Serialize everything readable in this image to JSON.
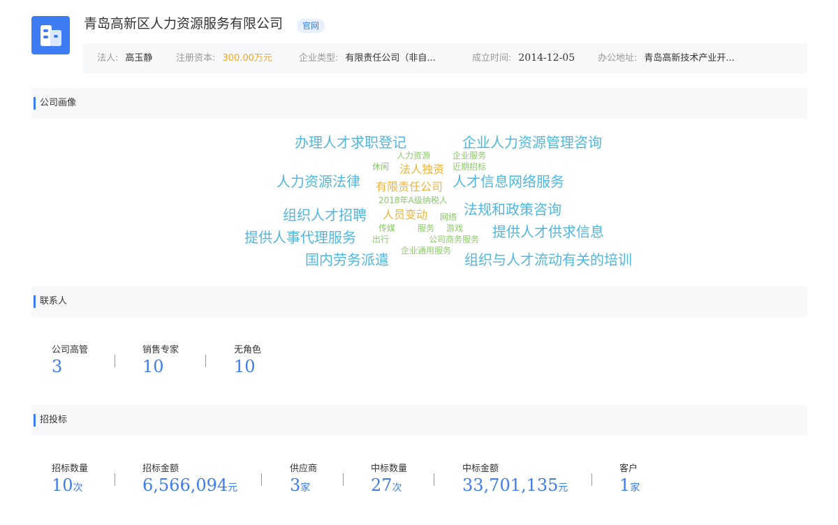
{
  "company": {
    "name": "青岛高新区人力资源服务有限公司",
    "badge": "官网",
    "info": [
      {
        "label": "法人:",
        "value": "高玉静"
      },
      {
        "label": "注册资本:",
        "value": "300.00万元"
      },
      {
        "label": "企业类型:",
        "value": "有限责任公司（非自..."
      },
      {
        "label": "成立时间:",
        "value": "2014-12-05"
      },
      {
        "label": "办公地址:",
        "value": "青岛高新技术产业开..."
      }
    ]
  },
  "sections": {
    "portrait": "公司画像",
    "contacts": "联系人",
    "bidding": "招投标"
  },
  "word_cloud": [
    "办理人才求职登记",
    "企业人力资源管理咨询",
    "人力资源",
    "企业服务",
    "休闲",
    "法人独资",
    "近期招标",
    "人力资源法律",
    "有限责任公司",
    "人才信息网络服务",
    "2018年A级纳税人",
    "组织人才招聘",
    "人员变动",
    "网络",
    "法规和政策咨询",
    "传媒",
    "服务",
    "游戏",
    "提供人事代理服务",
    "出行",
    "公司商务服务",
    "提供人才供求信息",
    "企业通用服务",
    "国内劳务派遣",
    "组织与人才流动有关的培训"
  ],
  "contacts": [
    {
      "label": "公司高管",
      "value": "3"
    },
    {
      "label": "销售专家",
      "value": "10"
    },
    {
      "label": "无角色",
      "value": "10"
    }
  ],
  "bidding": [
    {
      "label": "招标数量",
      "value": "10",
      "unit": "次"
    },
    {
      "label": "招标金额",
      "value": "6,566,094",
      "unit": "元"
    },
    {
      "label": "供应商",
      "value": "3",
      "unit": "家"
    },
    {
      "label": "中标数量",
      "value": "27",
      "unit": "次"
    },
    {
      "label": "中标金额",
      "value": "33,701,135",
      "unit": "元"
    },
    {
      "label": "客户",
      "value": "1",
      "unit": "家"
    }
  ],
  "colors": {
    "accent": "#3d7cf2",
    "money": "#f5a623",
    "cloud_large": "#4fb7e0",
    "cloud_small": "#8cc96a",
    "cloud_medium": "#f2b338"
  }
}
